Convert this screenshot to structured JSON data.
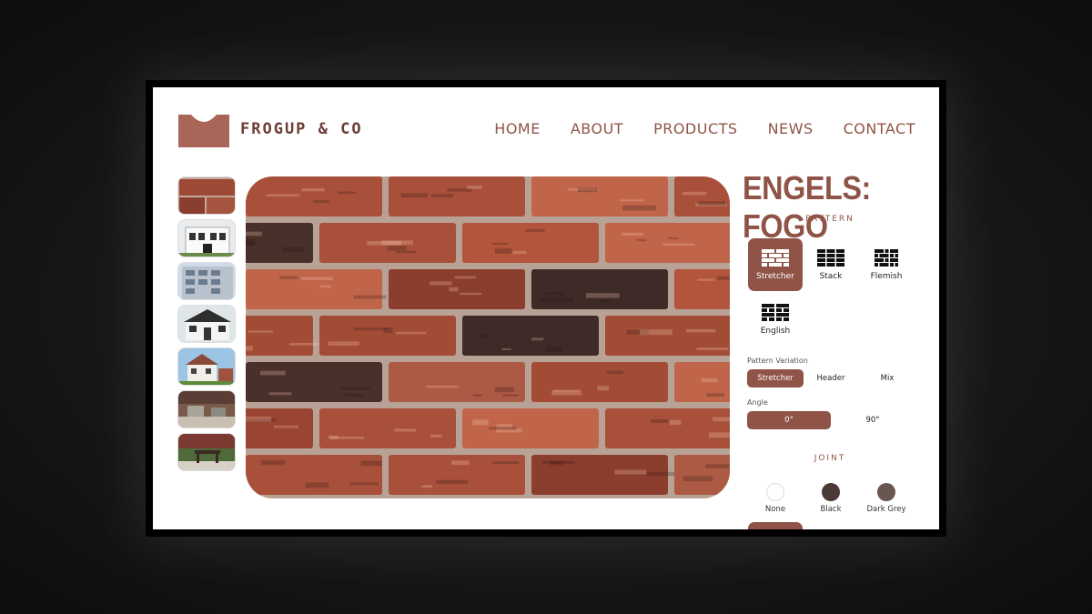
{
  "brand": {
    "name": "FROGUP & CO",
    "color": "#8f5447"
  },
  "nav": [
    {
      "label": "HOME"
    },
    {
      "label": "ABOUT"
    },
    {
      "label": "PRODUCTS"
    },
    {
      "label": "NEWS"
    },
    {
      "label": "CONTACT"
    }
  ],
  "thumbnails": [
    {
      "subject": "brick-texture"
    },
    {
      "subject": "white-building"
    },
    {
      "subject": "apartment-block"
    },
    {
      "subject": "modern-house"
    },
    {
      "subject": "tudor-house"
    },
    {
      "subject": "patio-seating"
    },
    {
      "subject": "garden-dining"
    }
  ],
  "product": {
    "title": "ENGELS: FOGO"
  },
  "pattern": {
    "heading": "PATTERN",
    "options": [
      {
        "label": "Stretcher",
        "icon": "stretcher-bond-icon",
        "selected": true
      },
      {
        "label": "Stack",
        "icon": "stack-bond-icon",
        "selected": false
      },
      {
        "label": "Flemish",
        "icon": "flemish-bond-icon",
        "selected": false
      },
      {
        "label": "English",
        "icon": "english-bond-icon",
        "selected": false
      }
    ]
  },
  "pattern_variation": {
    "label": "Pattern Variation",
    "options": [
      {
        "label": "Stretcher",
        "selected": true
      },
      {
        "label": "Header",
        "selected": false
      },
      {
        "label": "Mix",
        "selected": false
      }
    ]
  },
  "angle": {
    "label": "Angle",
    "options": [
      {
        "label": "0°",
        "selected": true
      },
      {
        "label": "90°",
        "selected": false
      }
    ]
  },
  "joint": {
    "heading": "JOINT",
    "options": [
      {
        "label": "None",
        "color": "#ffffff"
      },
      {
        "label": "Black",
        "color": "#4a3a36"
      },
      {
        "label": "Dark Grey",
        "color": "#6a5650"
      }
    ]
  }
}
